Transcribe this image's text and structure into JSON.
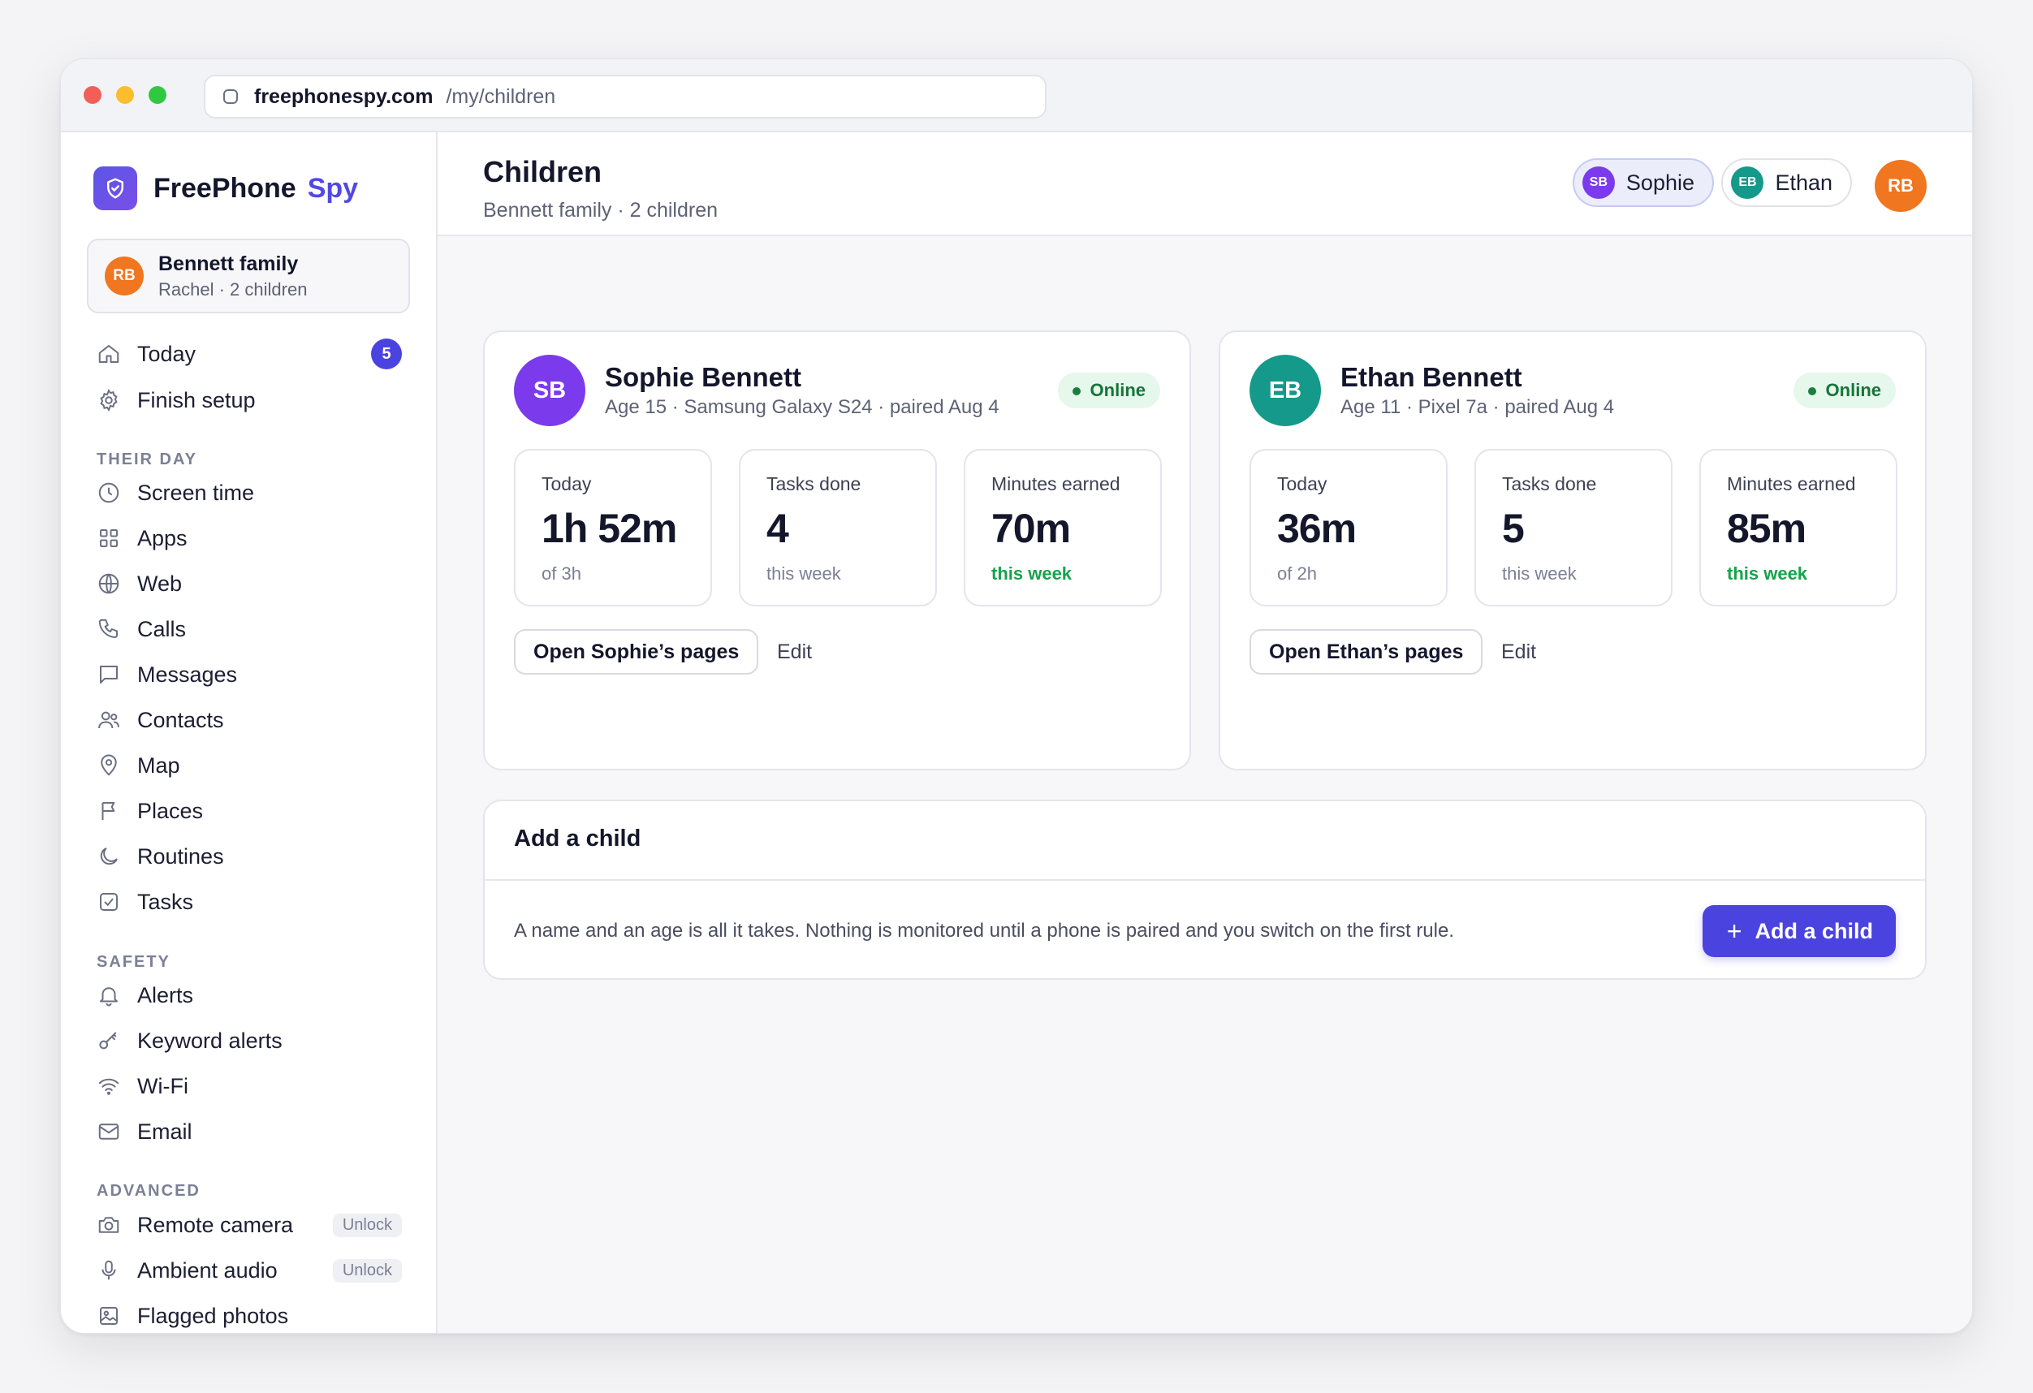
{
  "browser": {
    "host": "freephonespy.com",
    "path": "/my/children"
  },
  "brand": {
    "name": "FreePhone",
    "accent": "Spy"
  },
  "family": {
    "initials": "RB",
    "name": "Bennett family",
    "sub": "Rachel · 2 children"
  },
  "nav": {
    "top": [
      {
        "label": "Today",
        "icon": "home-icon",
        "badge": "5"
      },
      {
        "label": "Finish setup",
        "icon": "gear-icon"
      }
    ],
    "sections": [
      {
        "title": "THEIR DAY",
        "items": [
          {
            "label": "Screen time",
            "icon": "clock-icon"
          },
          {
            "label": "Apps",
            "icon": "grid-icon"
          },
          {
            "label": "Web",
            "icon": "globe-icon"
          },
          {
            "label": "Calls",
            "icon": "phone-icon"
          },
          {
            "label": "Messages",
            "icon": "chat-icon"
          },
          {
            "label": "Contacts",
            "icon": "users-icon"
          },
          {
            "label": "Map",
            "icon": "map-pin-icon"
          },
          {
            "label": "Places",
            "icon": "flag-icon"
          },
          {
            "label": "Routines",
            "icon": "moon-icon"
          },
          {
            "label": "Tasks",
            "icon": "checkbox-icon"
          }
        ]
      },
      {
        "title": "SAFETY",
        "items": [
          {
            "label": "Alerts",
            "icon": "bell-icon"
          },
          {
            "label": "Keyword alerts",
            "icon": "key-icon"
          },
          {
            "label": "Wi-Fi",
            "icon": "wifi-icon"
          },
          {
            "label": "Email",
            "icon": "mail-icon"
          }
        ]
      },
      {
        "title": "ADVANCED",
        "items": [
          {
            "label": "Remote camera",
            "icon": "camera-icon",
            "tag": "Unlock"
          },
          {
            "label": "Ambient audio",
            "icon": "microphone-icon",
            "tag": "Unlock"
          },
          {
            "label": "Flagged photos",
            "icon": "image-icon"
          }
        ]
      }
    ]
  },
  "header": {
    "title": "Children",
    "subtitle": "Bennett family · 2 children",
    "chips": [
      {
        "initials": "SB",
        "label": "Sophie"
      },
      {
        "initials": "EB",
        "label": "Ethan"
      }
    ],
    "user_initials": "RB"
  },
  "children": [
    {
      "initials": "SB",
      "name": "Sophie Bennett",
      "meta": "Age 15 · Samsung Galaxy S24 · paired Aug 4",
      "status": "Online",
      "stats": [
        {
          "label": "Today",
          "value": "1h 52m",
          "sub": "of 3h"
        },
        {
          "label": "Tasks done",
          "value": "4",
          "sub": "this week"
        },
        {
          "label": "Minutes earned",
          "value": "70m",
          "sub": "this week"
        }
      ],
      "open_label": "Open Sophie’s pages",
      "edit_label": "Edit"
    },
    {
      "initials": "EB",
      "name": "Ethan Bennett",
      "meta": "Age 11 · Pixel 7a · paired Aug 4",
      "status": "Online",
      "stats": [
        {
          "label": "Today",
          "value": "36m",
          "sub": "of 2h"
        },
        {
          "label": "Tasks done",
          "value": "5",
          "sub": "this week"
        },
        {
          "label": "Minutes earned",
          "value": "85m",
          "sub": "this week"
        }
      ],
      "open_label": "Open Ethan’s pages",
      "edit_label": "Edit"
    }
  ],
  "add_child": {
    "title": "Add a child",
    "description": "A name and an age is all it takes. Nothing is monitored until a phone is paired and you switch on the first rule.",
    "button": "Add a child"
  },
  "colors": {
    "accent": "#4a43e0",
    "online_bg": "#e6f7ec",
    "online_text": "#16753a",
    "avatar_rb": "#f07620",
    "avatar_sb": "#7c3aed",
    "avatar_eb": "#14998a"
  }
}
